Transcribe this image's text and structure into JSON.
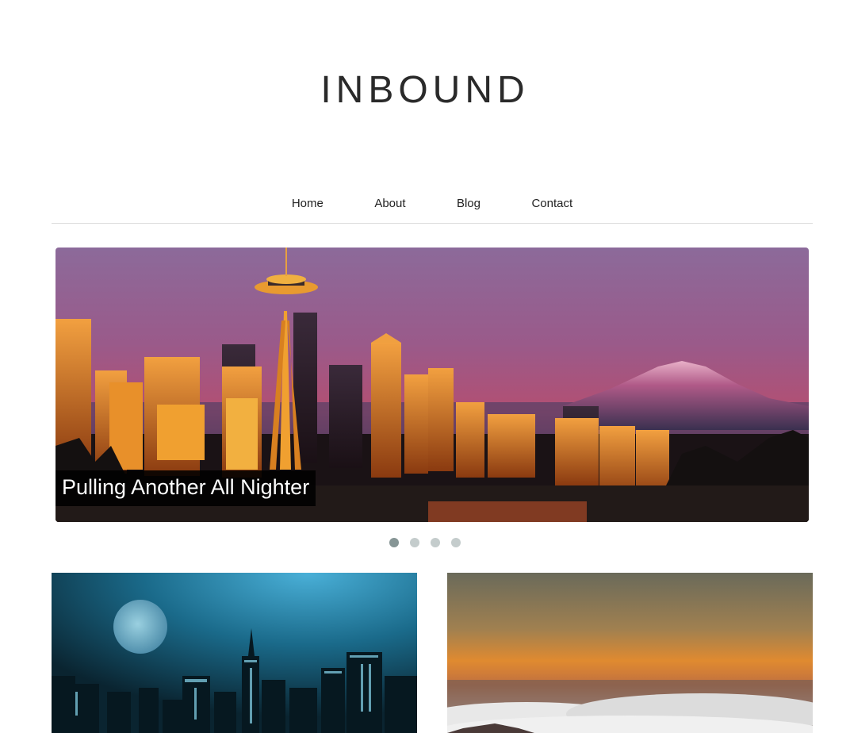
{
  "site": {
    "title": "INBOUND"
  },
  "nav": {
    "items": [
      {
        "label": "Home"
      },
      {
        "label": "About"
      },
      {
        "label": "Blog"
      },
      {
        "label": "Contact"
      }
    ]
  },
  "slider": {
    "caption": "Pulling Another All Nighter",
    "image": "seattle-skyline-sunset-photo",
    "dots": {
      "count": 4,
      "active_index": 0
    }
  },
  "cards": [
    {
      "image": "night-city-moon-photo"
    },
    {
      "image": "sunset-above-clouds-photo"
    }
  ],
  "colors": {
    "dot_active": "#869595",
    "dot_inactive": "#c4cccc",
    "caption_bg": "#000000",
    "divider": "#dddddd"
  }
}
